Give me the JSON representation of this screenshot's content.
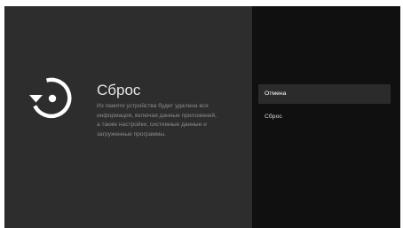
{
  "reset_screen": {
    "icon": "restore-history-icon",
    "title": "Сброс",
    "description": [
      "Из памяти устройства будет удалена вся",
      "информация, включая данные приложений,",
      "а также настройки, системные данные и",
      "загруженные программы."
    ]
  },
  "menu": {
    "selected_index": 0,
    "items": [
      {
        "label": "Отмена"
      },
      {
        "label": "Сброс"
      }
    ]
  },
  "colors": {
    "left_pane": "#2d2d2d",
    "right_pane": "#101010",
    "selection": "#2b2b2b",
    "title_text": "#e6e6e6",
    "description_text": "#8c8c8c"
  }
}
